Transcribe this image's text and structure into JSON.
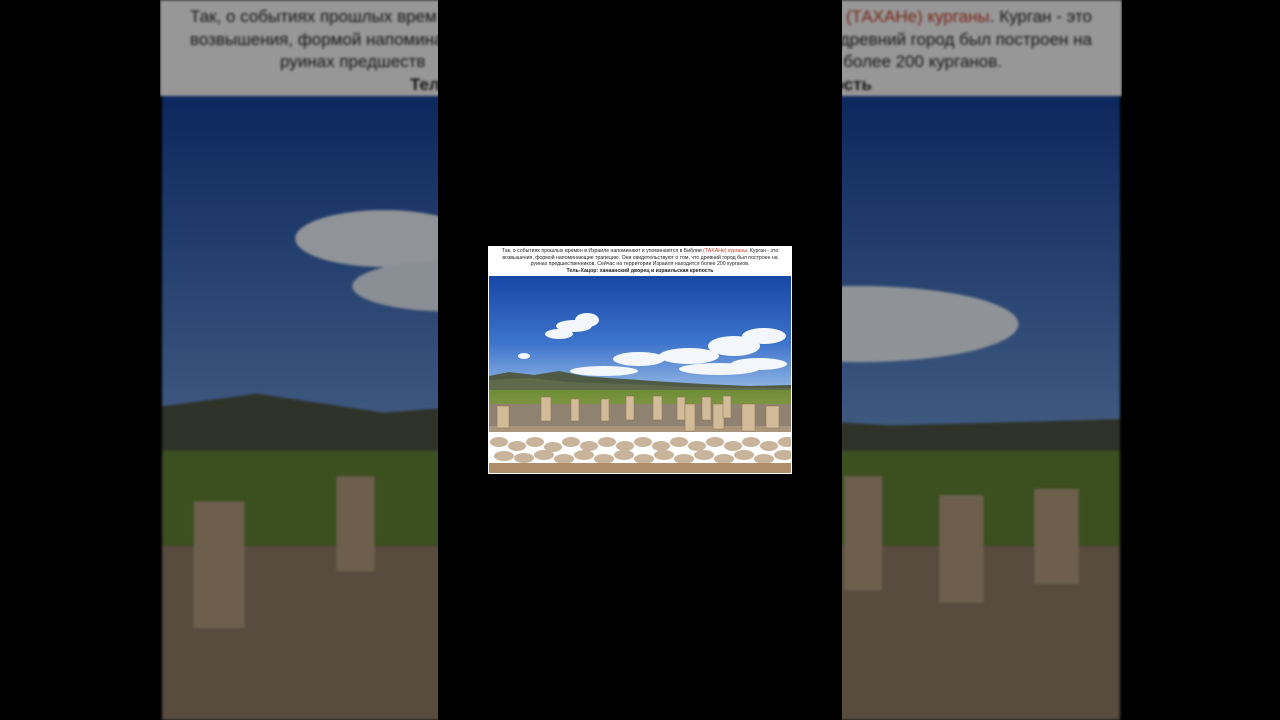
{
  "slide": {
    "caption_before": "Так, о событиях прошлых времен в Израиле напоминают и упоминаются в Библии ",
    "caption_highlight": "(ТАХАНе) курганы",
    "caption_after": ". Курган - это возвышения, формой напоминающие трапецию. Они свидетельствуют о том, что древний город был построен на руинах предшественников. Сейчас на территории Израиля находится более 200 курганов.",
    "subtitle": "Тель-Хацор: ханаанский дворец и израильская крепость",
    "photo_alt": "Ruins of stone pillars at Tel Hazor under a blue sky with clouds"
  },
  "background": {
    "caption_before": "Так, о событиях прошлых врем",
    "caption_highlight": "(ТАХАНе) курганы",
    "caption_after": ". Курган - это",
    "line2_left": "возвышения, формой напомина",
    "line2_right": "древний город был построен на",
    "line3_left": "руинах предшеств",
    "line3_right": "более 200 курганов.",
    "line4_left": "Тел",
    "line4_right": "ость"
  },
  "colors": {
    "highlight": "#c0392b",
    "sky_top": "#1d4fa8",
    "sky_bottom": "#5c8fd6",
    "grass": "#6c8a3a",
    "stone": "#b9a183"
  }
}
